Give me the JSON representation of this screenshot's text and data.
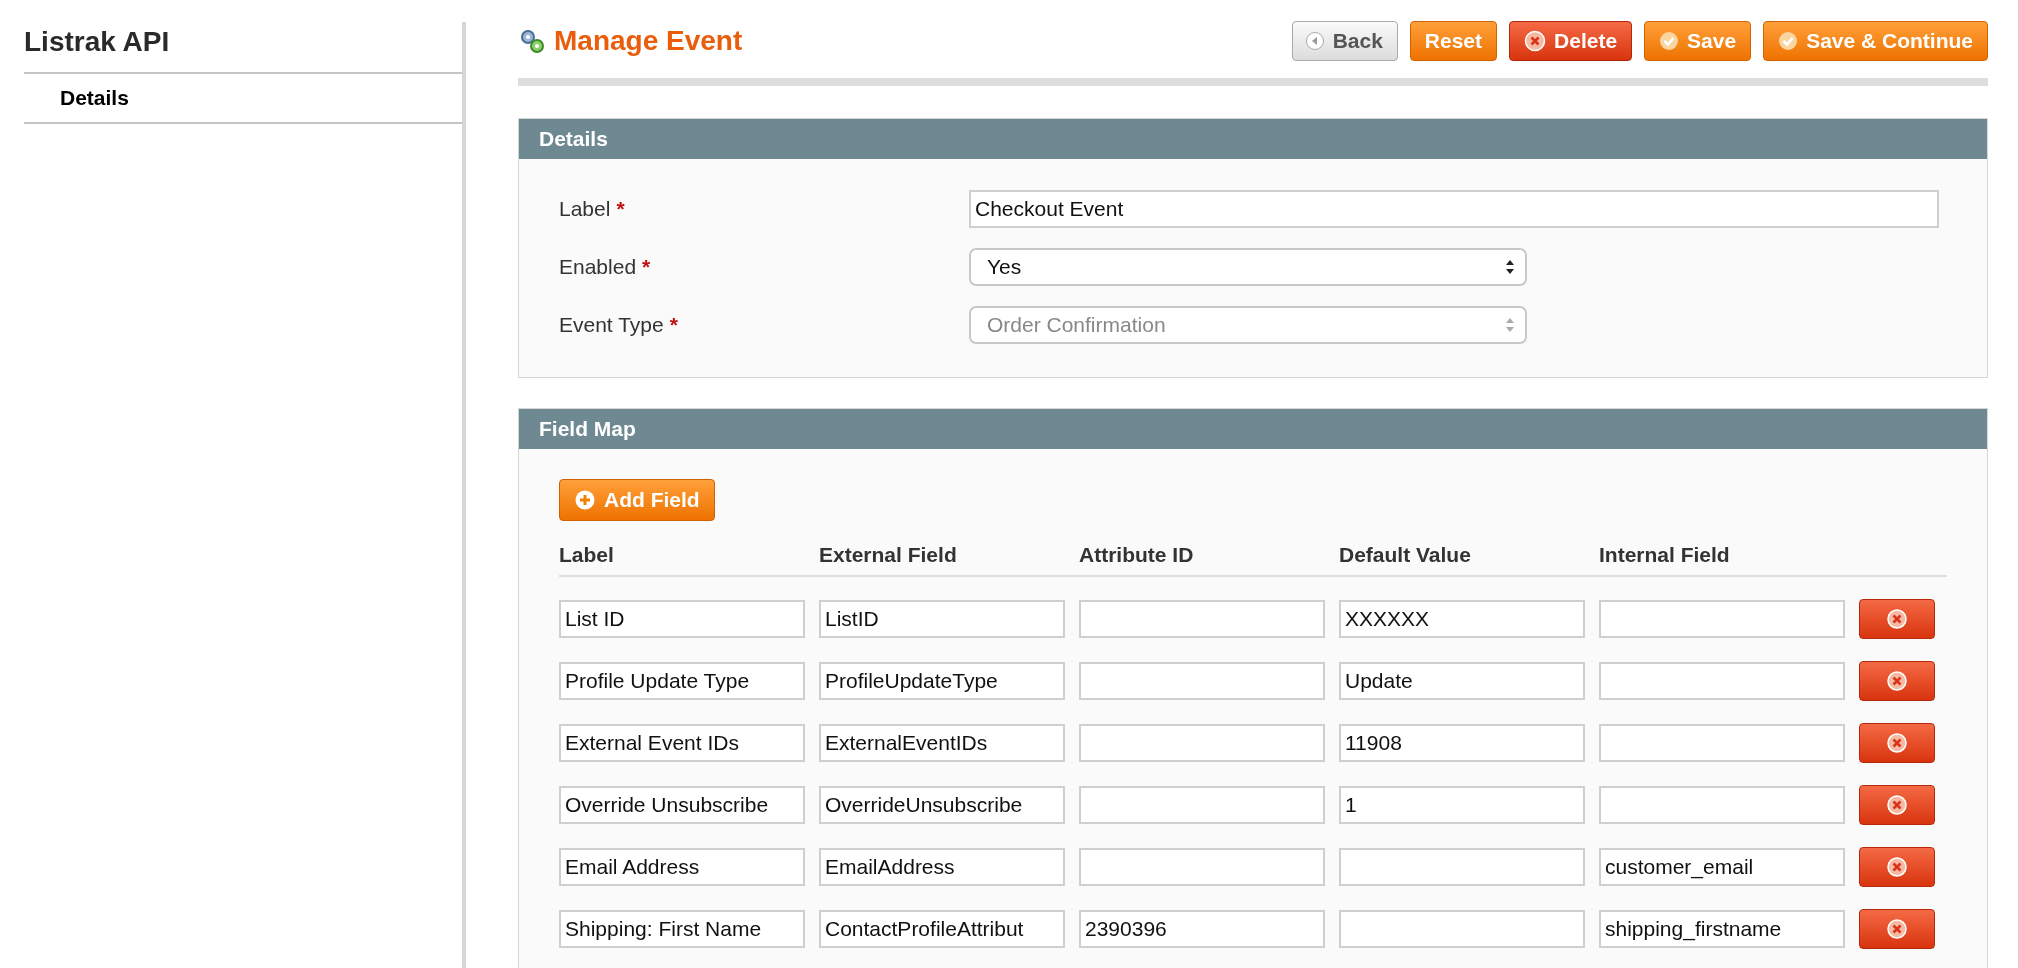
{
  "sidebar": {
    "title": "Listrak API",
    "items": [
      {
        "label": "Details",
        "selected": true
      }
    ]
  },
  "header": {
    "title": "Manage Event",
    "buttons": [
      {
        "label": "Back",
        "kind": "back"
      },
      {
        "label": "Reset",
        "kind": "plain"
      },
      {
        "label": "Delete",
        "kind": "delete"
      },
      {
        "label": "Save",
        "kind": "save"
      },
      {
        "label": "Save & Continue",
        "kind": "save"
      }
    ]
  },
  "details": {
    "title": "Details",
    "fields": [
      {
        "label": "Label",
        "required_mark": "*",
        "kind": "text",
        "value": "Checkout Event"
      },
      {
        "label": "Enabled",
        "required_mark": "*",
        "kind": "select",
        "value": "Yes",
        "disabled": false
      },
      {
        "label": "Event Type",
        "required_mark": "*",
        "kind": "select",
        "value": "Order Confirmation",
        "disabled": true
      }
    ]
  },
  "field_map": {
    "title": "Field Map",
    "add_button": "Add Field",
    "columns": [
      "Label",
      "External Field",
      "Attribute ID",
      "Default Value",
      "Internal Field"
    ],
    "rows": [
      [
        "List ID",
        "ListID",
        "",
        "XXXXXX",
        ""
      ],
      [
        "Profile Update Type",
        "ProfileUpdateType",
        "",
        "Update",
        ""
      ],
      [
        "External Event IDs",
        "ExternalEventIDs",
        "",
        "11908",
        ""
      ],
      [
        "Override Unsubscribe",
        "OverrideUnsubscribe",
        "",
        "1",
        ""
      ],
      [
        "Email Address",
        "EmailAddress",
        "",
        "",
        "customer_email"
      ],
      [
        "Shipping: First Name",
        "ContactProfileAttribut",
        "2390396",
        "",
        "shipping_firstname"
      ]
    ]
  }
}
